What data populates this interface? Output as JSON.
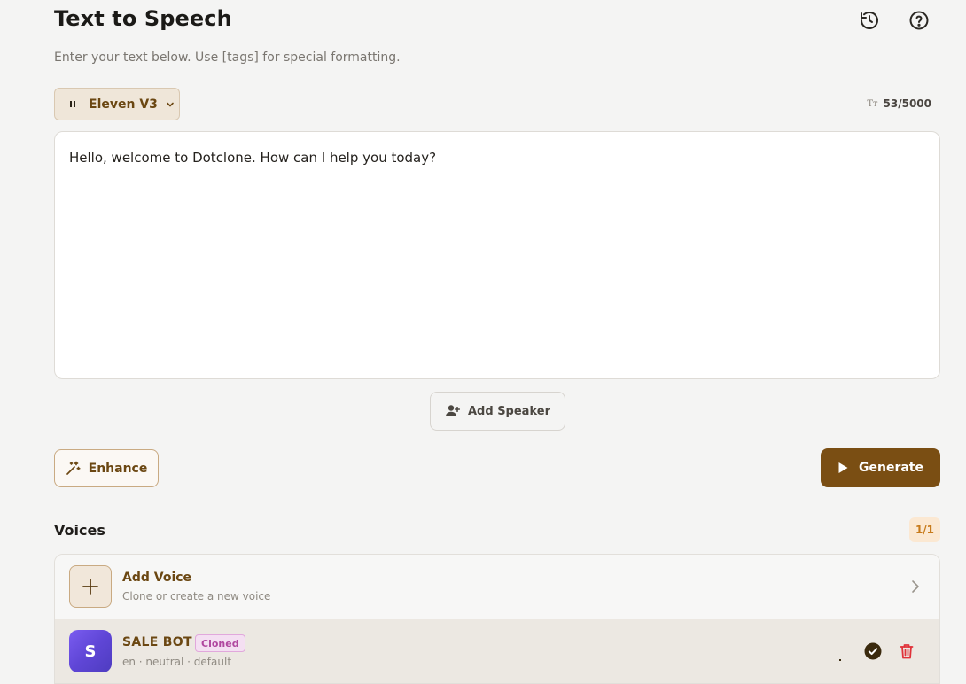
{
  "header": {
    "title": "Text to Speech",
    "subtitle": "Enter your text below. Use [tags] for special formatting."
  },
  "toolbar": {
    "model_label": "Eleven V3",
    "char_icon": "Tт",
    "char_count": "53/5000"
  },
  "editor": {
    "text": "Hello, welcome to Dotclone. How can I help you today?"
  },
  "actions": {
    "add_speaker_label": "Add Speaker",
    "enhance_label": "Enhance",
    "generate_label": "Generate"
  },
  "voices": {
    "title": "Voices",
    "count": "1/1",
    "add_voice": {
      "title": "Add Voice",
      "subtitle": "Clone or create a new voice"
    },
    "items": [
      {
        "initial": "S",
        "name": "SALE BOT",
        "badge": "Cloned",
        "meta": "en · neutral · default",
        "selected": true
      }
    ]
  },
  "colors": {
    "accent": "#7a4e13",
    "background": "#f4f4f3",
    "badge": "#b0479f",
    "delete": "#e0323a"
  }
}
